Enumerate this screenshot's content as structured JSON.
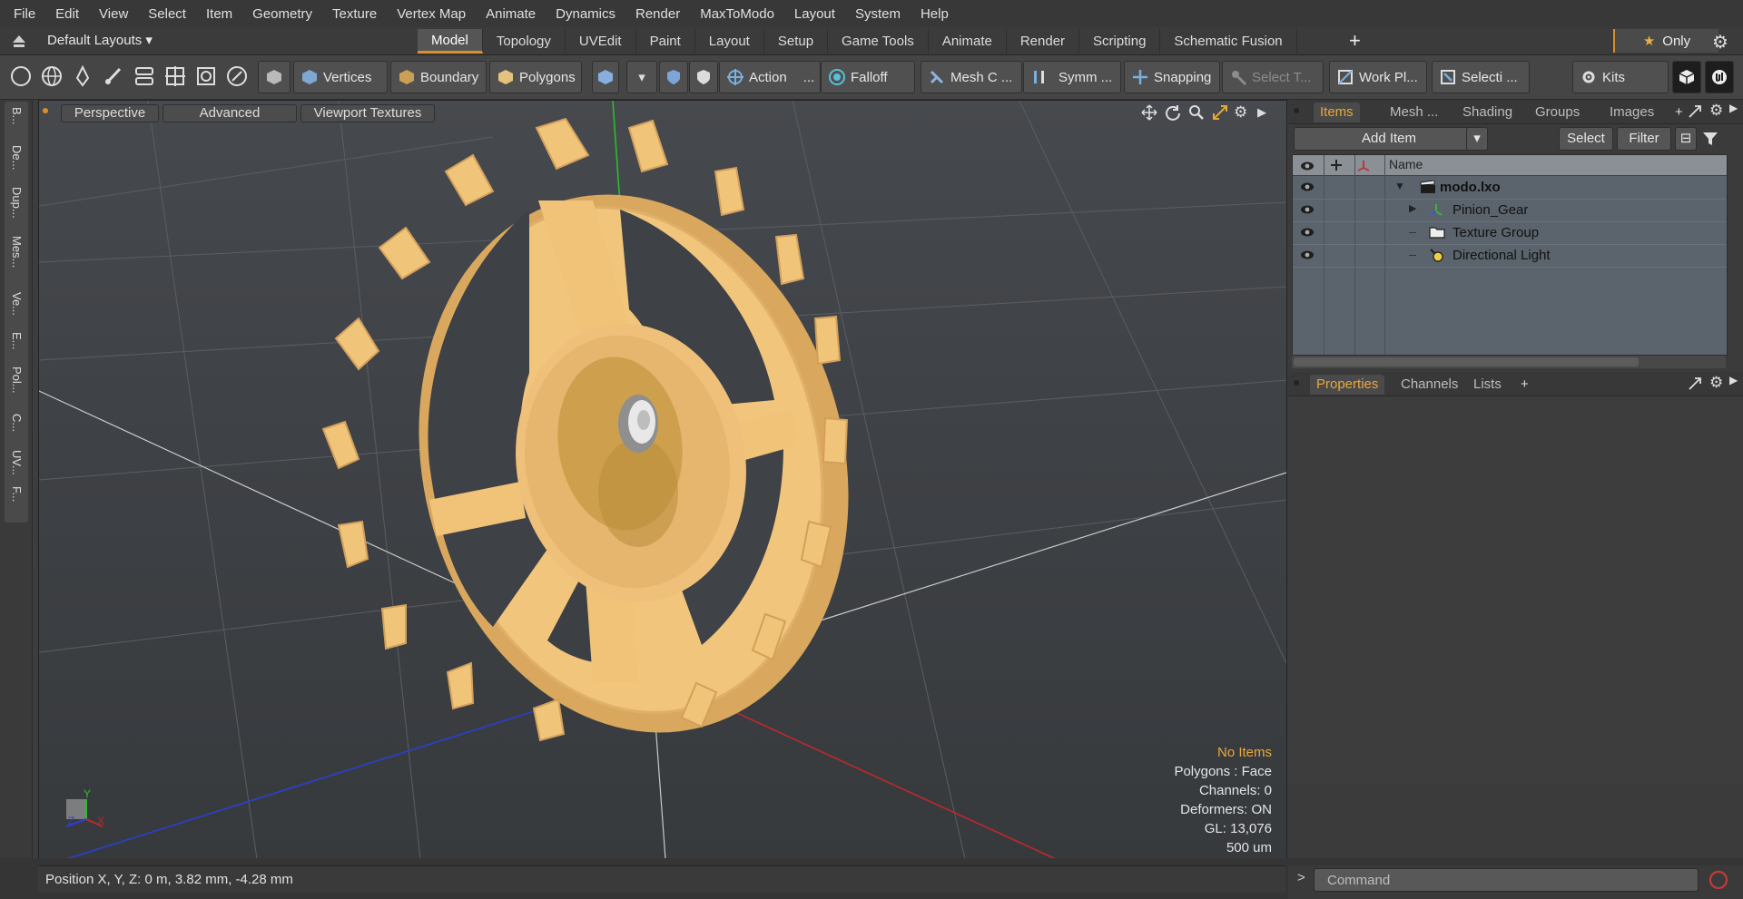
{
  "menu": [
    "File",
    "Edit",
    "View",
    "Select",
    "Item",
    "Geometry",
    "Texture",
    "Vertex Map",
    "Animate",
    "Dynamics",
    "Render",
    "MaxToModo",
    "Layout",
    "System",
    "Help"
  ],
  "layout": {
    "selector": "Default Layouts ▾",
    "tabs": [
      "Model",
      "Topology",
      "UVEdit",
      "Paint",
      "Layout",
      "Setup",
      "Game Tools",
      "Animate",
      "Render",
      "Scripting",
      "Schematic Fusion"
    ],
    "active_tab": "Model",
    "add": "+",
    "only": "Only"
  },
  "toolbar": {
    "vertices": "Vertices",
    "boundary": "Boundary",
    "polygons": "Polygons",
    "action": "Action",
    "action_more": "...",
    "falloff": "Falloff",
    "mesh": "Mesh C ...",
    "symm": "Symm ...",
    "snapping": "Snapping",
    "select_t": "Select T...",
    "workplane": "Work Pl...",
    "selection": "Selecti ...",
    "kits": "Kits"
  },
  "left_tabs": [
    "B...",
    "De...",
    "Dup...",
    "Mes...",
    "Ve...",
    "E...",
    "Pol...",
    "C...",
    "UV...",
    "F..."
  ],
  "viewport": {
    "tabs": [
      "Perspective",
      "Advanced",
      "Viewport Textures"
    ],
    "info": {
      "selection": "No Items",
      "polygons": "Polygons : Face",
      "channels": "Channels: 0",
      "deformers": "Deformers: ON",
      "gl": "GL: 13,076",
      "scale": "500 um"
    },
    "axis_labels": {
      "y": "Y",
      "z": "Z",
      "x": "X"
    }
  },
  "right_panel": {
    "top_tabs": [
      "Items",
      "Mesh ...",
      "Shading",
      "Groups",
      "Images"
    ],
    "active_top_tab": "Items",
    "add_item": "Add Item",
    "select": "Select",
    "filter": "Filter",
    "column_name": "Name",
    "items": [
      {
        "name": "modo.lxo",
        "icon": "scene-icon",
        "bold": true
      },
      {
        "name": "Pinion_Gear",
        "icon": "mesh-locator-icon",
        "bold": false
      },
      {
        "name": "Texture Group",
        "icon": "texture-group-icon",
        "bold": false
      },
      {
        "name": "Directional Light",
        "icon": "light-icon",
        "bold": false
      }
    ],
    "bottom_tabs": [
      "Properties",
      "Channels",
      "Lists"
    ],
    "active_bottom_tab": "Properties",
    "add": "+"
  },
  "status": {
    "position": "Position X, Y, Z:   0 m, 3.82 mm, -4.28 mm",
    "command_placeholder": "Command",
    "prompt": ">"
  },
  "colors": {
    "accent": "#d9902c",
    "highlight_text": "#e8a83c",
    "gear": "#f1c57b",
    "axis_x": "#c0282c",
    "axis_y": "#2bbd2b",
    "axis_z": "#2c3fd0"
  }
}
